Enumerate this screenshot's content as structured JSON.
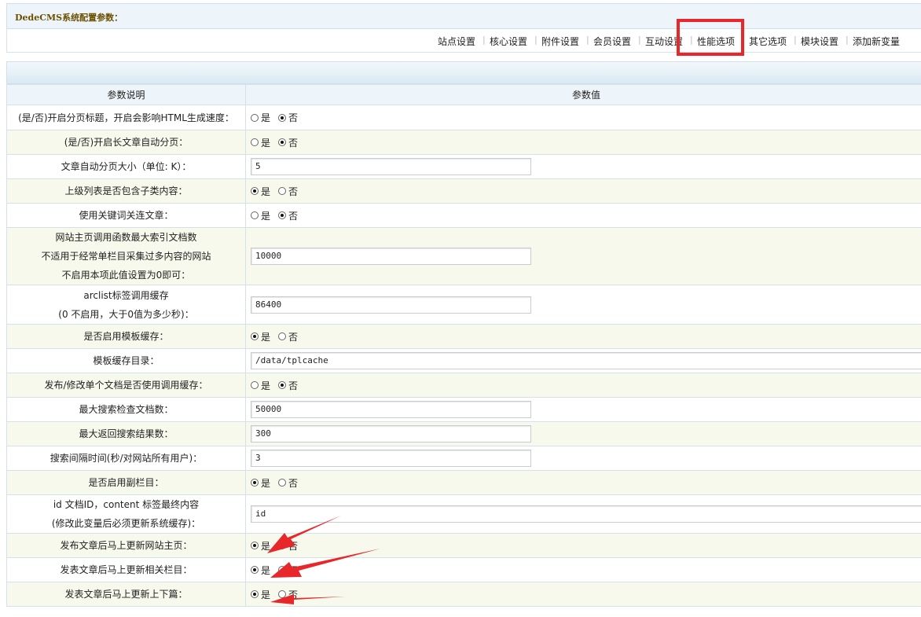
{
  "header": {
    "title": "DedeCMS系统配置参数："
  },
  "tabs": [
    {
      "label": "站点设置"
    },
    {
      "label": "核心设置"
    },
    {
      "label": "附件设置"
    },
    {
      "label": "会员设置"
    },
    {
      "label": "互动设置"
    },
    {
      "label": "性能选项"
    },
    {
      "label": "其它选项"
    },
    {
      "label": "模块设置"
    },
    {
      "label": "添加新变量"
    }
  ],
  "table": {
    "col_desc": "参数说明",
    "col_value": "参数值",
    "radio_yes": "是",
    "radio_no": "否",
    "rows": [
      {
        "desc": [
          "(是/否)开启分页标题，开启会影响HTML生成速度："
        ],
        "type": "radio",
        "value": "否"
      },
      {
        "desc": [
          "(是/否)开启长文章自动分页："
        ],
        "type": "radio",
        "value": "否"
      },
      {
        "desc": [
          "文章自动分页大小（单位: K）："
        ],
        "type": "text",
        "value": "5",
        "short": true
      },
      {
        "desc": [
          "上级列表是否包含子类内容："
        ],
        "type": "radio",
        "value": "是"
      },
      {
        "desc": [
          "使用关键词关连文章："
        ],
        "type": "radio",
        "value": "否"
      },
      {
        "desc": [
          "网站主页调用函数最大索引文档数",
          "不适用于经常单栏目采集过多内容的网站",
          "不启用本项此值设置为0即可："
        ],
        "type": "text",
        "value": "10000",
        "short": true
      },
      {
        "desc": [
          "arclist标签调用缓存",
          "(0 不启用，大于0值为多少秒)："
        ],
        "type": "text",
        "value": "86400",
        "short": true
      },
      {
        "desc": [
          "是否启用模板缓存："
        ],
        "type": "radio",
        "value": "是"
      },
      {
        "desc": [
          "模板缓存目录："
        ],
        "type": "text",
        "value": "/data/tplcache",
        "short": false
      },
      {
        "desc": [
          "发布/修改单个文档是否使用调用缓存："
        ],
        "type": "radio",
        "value": "否"
      },
      {
        "desc": [
          "最大搜索检查文档数："
        ],
        "type": "text",
        "value": "50000",
        "short": true
      },
      {
        "desc": [
          "最大返回搜索结果数："
        ],
        "type": "text",
        "value": "300",
        "short": true
      },
      {
        "desc": [
          "搜索间隔时间(秒/对网站所有用户)："
        ],
        "type": "text",
        "value": "3",
        "short": true
      },
      {
        "desc": [
          "是否启用副栏目："
        ],
        "type": "radio",
        "value": "是"
      },
      {
        "desc": [
          "id 文档ID，content 标签最终内容",
          "(修改此变量后必须更新系统缓存)："
        ],
        "type": "text",
        "value": "id",
        "short": false
      },
      {
        "desc": [
          "发布文章后马上更新网站主页："
        ],
        "type": "radio",
        "value": "是"
      },
      {
        "desc": [
          "发表文章后马上更新相关栏目："
        ],
        "type": "radio",
        "value": "是"
      },
      {
        "desc": [
          "发表文章后马上更新上下篇："
        ],
        "type": "radio",
        "value": "是"
      }
    ]
  },
  "colors": {
    "highlight": "#e8272b",
    "arrow": "#e8272b",
    "row_alt": "#f7f9ec",
    "border": "#d3e1ea"
  }
}
